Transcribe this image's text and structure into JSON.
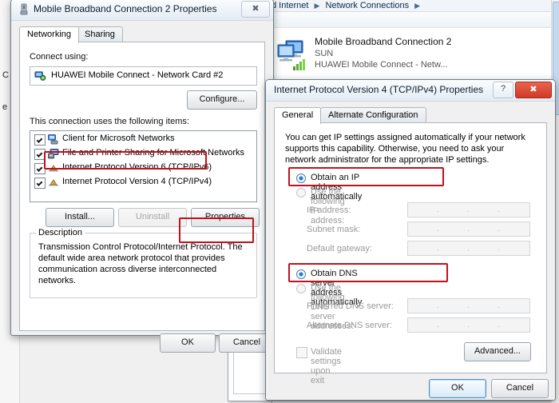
{
  "explorer": {
    "breadcrumb": [
      "d Internet",
      "Network Connections",
      ""
    ],
    "connection": {
      "name": "Mobile Broadband Connection 2",
      "network": "SUN",
      "device": "HUAWEI Mobile Connect - Netw...",
      "icon": "network-computers-icon"
    }
  },
  "conn_props": {
    "title": "Mobile Broadband Connection 2 Properties",
    "title_icon": "network-adapter-icon",
    "close_label": "✖",
    "tabs": [
      {
        "label": "Networking",
        "active": true
      },
      {
        "label": "Sharing",
        "active": false
      }
    ],
    "connect_using_label": "Connect using:",
    "adapter_name": "HUAWEI Mobile Connect - Network Card #2",
    "adapter_icon": "network-card-icon",
    "configure_label": "Configure...",
    "items_label": "This connection uses the following items:",
    "items": [
      {
        "label": "Client for Microsoft Networks",
        "checked": true,
        "icon": "client-network-icon",
        "highlighted": false
      },
      {
        "label": "File and Printer Sharing for Microsoft Networks",
        "checked": true,
        "icon": "printer-sharing-icon",
        "highlighted": false
      },
      {
        "label": "Internet Protocol Version 6 (TCP/IPv6)",
        "checked": true,
        "icon": "protocol-icon",
        "highlighted": false
      },
      {
        "label": "Internet Protocol Version 4 (TCP/IPv4)",
        "checked": true,
        "icon": "protocol-icon",
        "highlighted": true
      }
    ],
    "install_label": "Install...",
    "uninstall_label": "Uninstall",
    "properties_label": "Properties",
    "properties_highlighted": true,
    "description_title": "Description",
    "description_text": "Transmission Control Protocol/Internet Protocol. The default wide area network protocol that provides communication across diverse interconnected networks.",
    "ok_label": "OK",
    "cancel_label": "Cancel"
  },
  "ipv4_props": {
    "title": "Internet Protocol Version 4 (TCP/IPv4) Properties",
    "help_label": "?",
    "close_label": "✖",
    "tabs": [
      {
        "label": "General",
        "active": true
      },
      {
        "label": "Alternate Configuration",
        "active": false
      }
    ],
    "intro_text": "You can get IP settings assigned automatically if your network supports this capability. Otherwise, you need to ask your network administrator for the appropriate IP settings.",
    "ip_mode": {
      "auto_label": "Obtain an IP address automatically",
      "auto_selected": true,
      "auto_highlighted": true,
      "manual_label": "Use the following IP address:",
      "manual_selected": false
    },
    "ip_fields": [
      {
        "label": "IP address:",
        "value": "",
        "disabled": true
      },
      {
        "label": "Subnet mask:",
        "value": "",
        "disabled": true
      },
      {
        "label": "Default gateway:",
        "value": "",
        "disabled": true
      }
    ],
    "dns_mode": {
      "auto_label": "Obtain DNS server address automatically",
      "auto_selected": true,
      "auto_highlighted": true,
      "manual_label": "Use the following DNS server addresses:",
      "manual_selected": false
    },
    "dns_fields": [
      {
        "label": "Preferred DNS server:",
        "value": "",
        "disabled": true
      },
      {
        "label": "Alternate DNS server:",
        "value": "",
        "disabled": true
      }
    ],
    "validate_label": "Validate settings upon exit",
    "validate_checked": false,
    "advanced_label": "Advanced...",
    "ok_label": "OK",
    "cancel_label": "Cancel"
  },
  "colors": {
    "highlight_red": "#c0121a",
    "close_red": "#d23d2a",
    "accent_blue": "#2a7fd4"
  }
}
